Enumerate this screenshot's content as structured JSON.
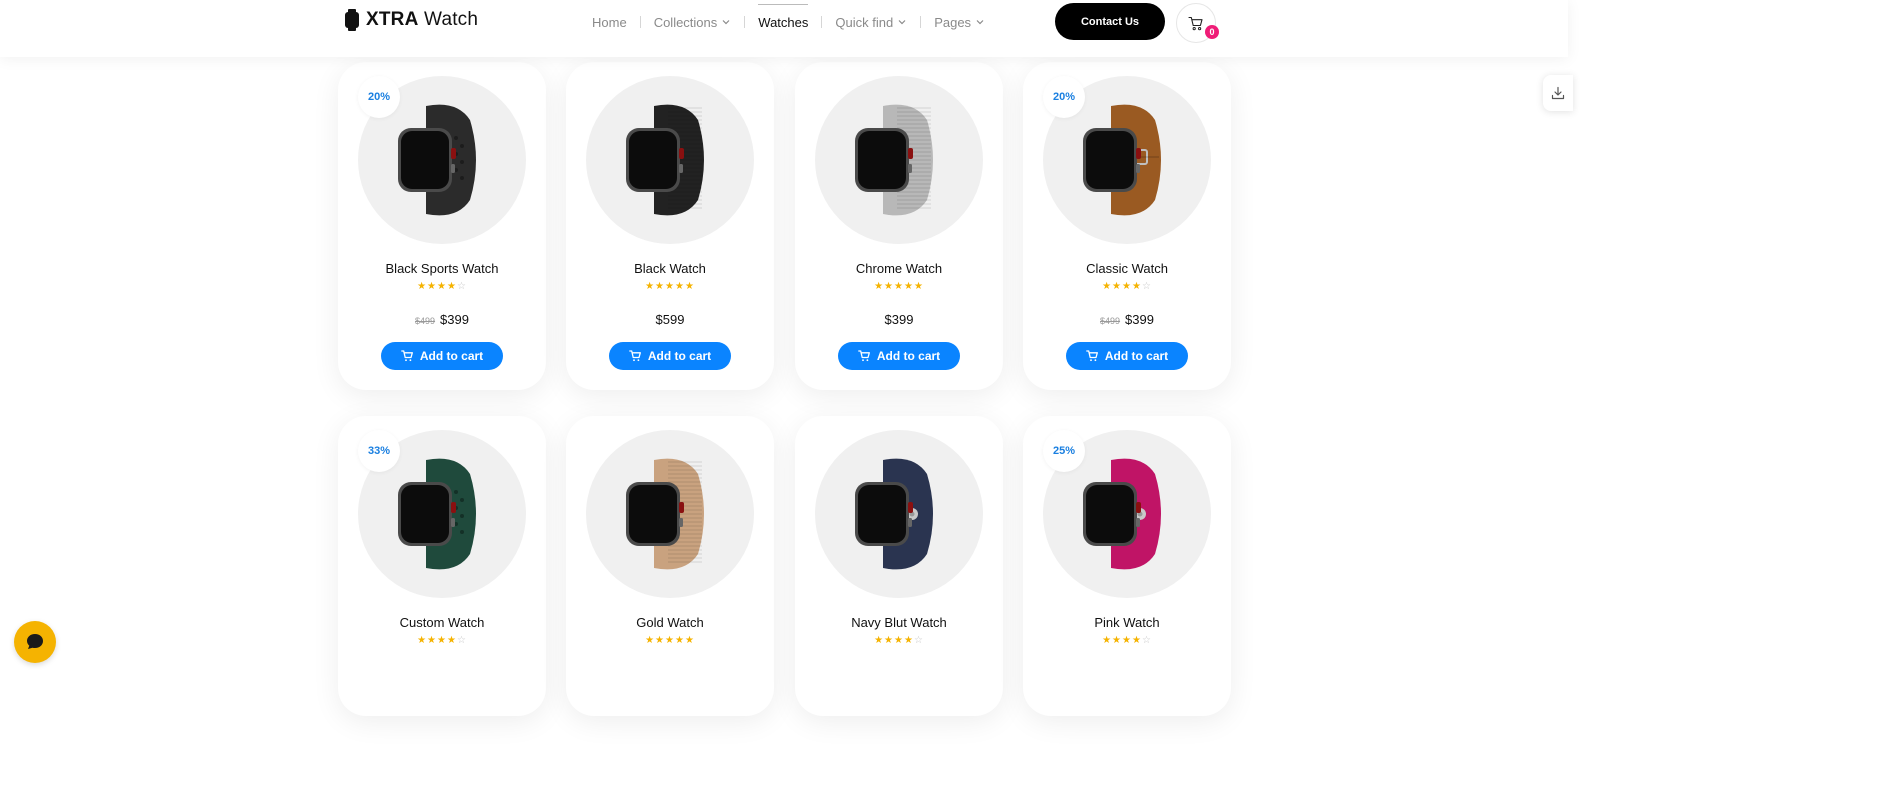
{
  "header": {
    "logo_bold": "XTRA",
    "logo_rest": " Watch",
    "nav": [
      {
        "label": "Home",
        "dropdown": false,
        "active": false
      },
      {
        "label": "Collections",
        "dropdown": true,
        "active": false
      },
      {
        "label": "Watches",
        "dropdown": false,
        "active": true
      },
      {
        "label": "Quick find",
        "dropdown": true,
        "active": false
      },
      {
        "label": "Pages",
        "dropdown": true,
        "active": false
      }
    ],
    "contact_label": "Contact Us",
    "cart_count": "0"
  },
  "colors": {
    "accent": "#0a84ff",
    "badge_text": "#1a7fe0",
    "star": "#f5b301",
    "cart_badge": "#ef1c77",
    "chat": "#f5b301"
  },
  "products": [
    {
      "name": "Black Sports Watch",
      "badge": "20%",
      "rating": 4,
      "old_price": "$499",
      "price": "$399",
      "cta": "Add to cart",
      "band_color": "#2b2b2b",
      "band_style": "sport"
    },
    {
      "name": "Black Watch",
      "badge": "",
      "rating": 5,
      "old_price": "",
      "price": "$599",
      "cta": "Add to cart",
      "band_color": "#222222",
      "band_style": "mesh"
    },
    {
      "name": "Chrome Watch",
      "badge": "",
      "rating": 5,
      "old_price": "",
      "price": "$399",
      "cta": "Add to cart",
      "band_color": "#b8b8b8",
      "band_style": "mesh"
    },
    {
      "name": "Classic Watch",
      "badge": "20%",
      "rating": 4,
      "old_price": "$499",
      "price": "$399",
      "cta": "Add to cart",
      "band_color": "#9a5a22",
      "band_style": "leather"
    },
    {
      "name": "Custom Watch",
      "badge": "33%",
      "rating": 4,
      "old_price": "",
      "price": "",
      "cta": "",
      "band_color": "#1f4a3c",
      "band_style": "sport"
    },
    {
      "name": "Gold Watch",
      "badge": "",
      "rating": 5,
      "old_price": "",
      "price": "",
      "cta": "",
      "band_color": "#c9a27f",
      "band_style": "mesh"
    },
    {
      "name": "Navy Blut Watch",
      "badge": "",
      "rating": 4,
      "old_price": "",
      "price": "",
      "cta": "",
      "band_color": "#2a3450",
      "band_style": "solo"
    },
    {
      "name": "Pink Watch",
      "badge": "25%",
      "rating": 4,
      "old_price": "",
      "price": "",
      "cta": "",
      "band_color": "#c01466",
      "band_style": "solo"
    }
  ]
}
